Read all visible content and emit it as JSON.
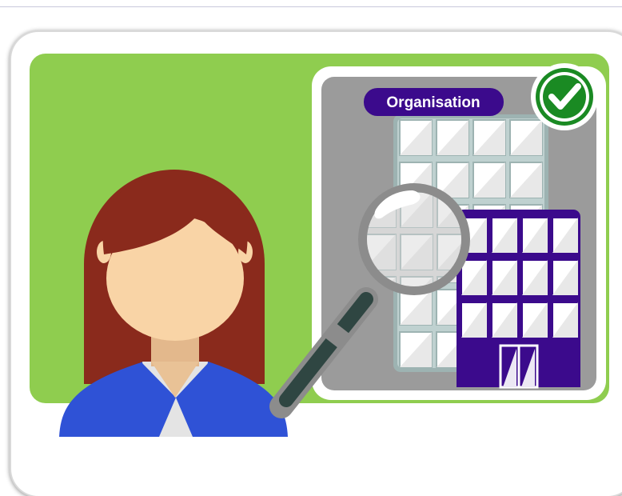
{
  "illustration": {
    "organisation_label": "Organisation",
    "icons": [
      "person-icon",
      "magnifying-glass-icon",
      "building-icon",
      "checkmark-badge-icon"
    ],
    "colors": {
      "background_panel": "#8fcd4f",
      "building_panel": "#9b9b9b",
      "label_fill": "#3b0a8c",
      "label_text": "#ffffff",
      "purple_building": "#3b0a8c",
      "check_green": "#1a8a23",
      "hair": "#8a2a1c",
      "skin": "#f9d4a6",
      "jacket": "#2f52d6",
      "shirt": "#e4e4e4"
    }
  }
}
